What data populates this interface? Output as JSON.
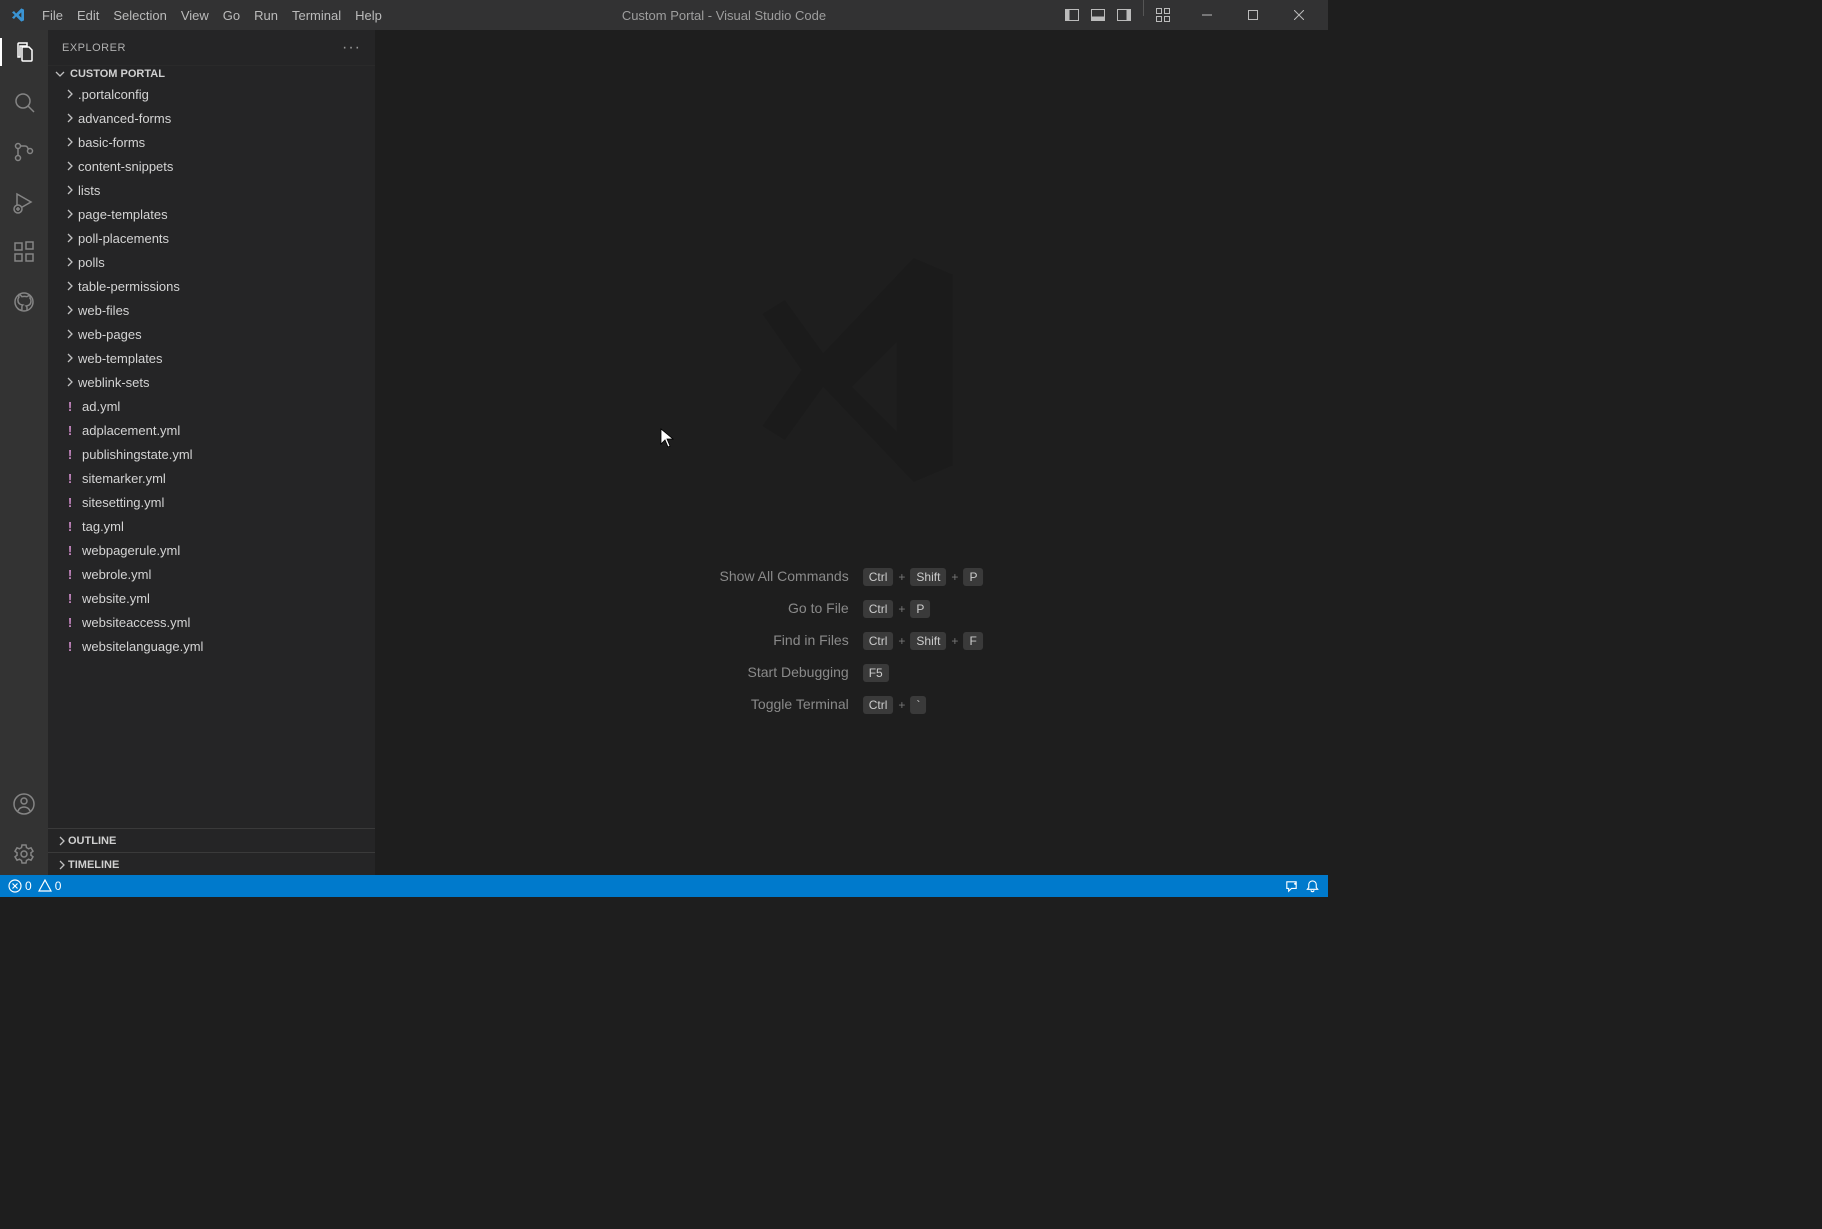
{
  "title": "Custom Portal - Visual Studio Code",
  "menubar": [
    "File",
    "Edit",
    "Selection",
    "View",
    "Go",
    "Run",
    "Terminal",
    "Help"
  ],
  "sidebar": {
    "header": "EXPLORER",
    "root": "CUSTOM PORTAL",
    "folders": [
      ".portalconfig",
      "advanced-forms",
      "basic-forms",
      "content-snippets",
      "lists",
      "page-templates",
      "poll-placements",
      "polls",
      "table-permissions",
      "web-files",
      "web-pages",
      "web-templates",
      "weblink-sets"
    ],
    "files": [
      "ad.yml",
      "adplacement.yml",
      "publishingstate.yml",
      "sitemarker.yml",
      "sitesetting.yml",
      "tag.yml",
      "webpagerule.yml",
      "webrole.yml",
      "website.yml",
      "websiteaccess.yml",
      "websitelanguage.yml"
    ],
    "outline": "OUTLINE",
    "timeline": "TIMELINE"
  },
  "shortcuts": [
    {
      "label": "Show All Commands",
      "keys": [
        "Ctrl",
        "Shift",
        "P"
      ]
    },
    {
      "label": "Go to File",
      "keys": [
        "Ctrl",
        "P"
      ]
    },
    {
      "label": "Find in Files",
      "keys": [
        "Ctrl",
        "Shift",
        "F"
      ]
    },
    {
      "label": "Start Debugging",
      "keys": [
        "F5"
      ]
    },
    {
      "label": "Toggle Terminal",
      "keys": [
        "Ctrl",
        "`"
      ]
    }
  ],
  "status": {
    "errors": "0",
    "warnings": "0"
  }
}
